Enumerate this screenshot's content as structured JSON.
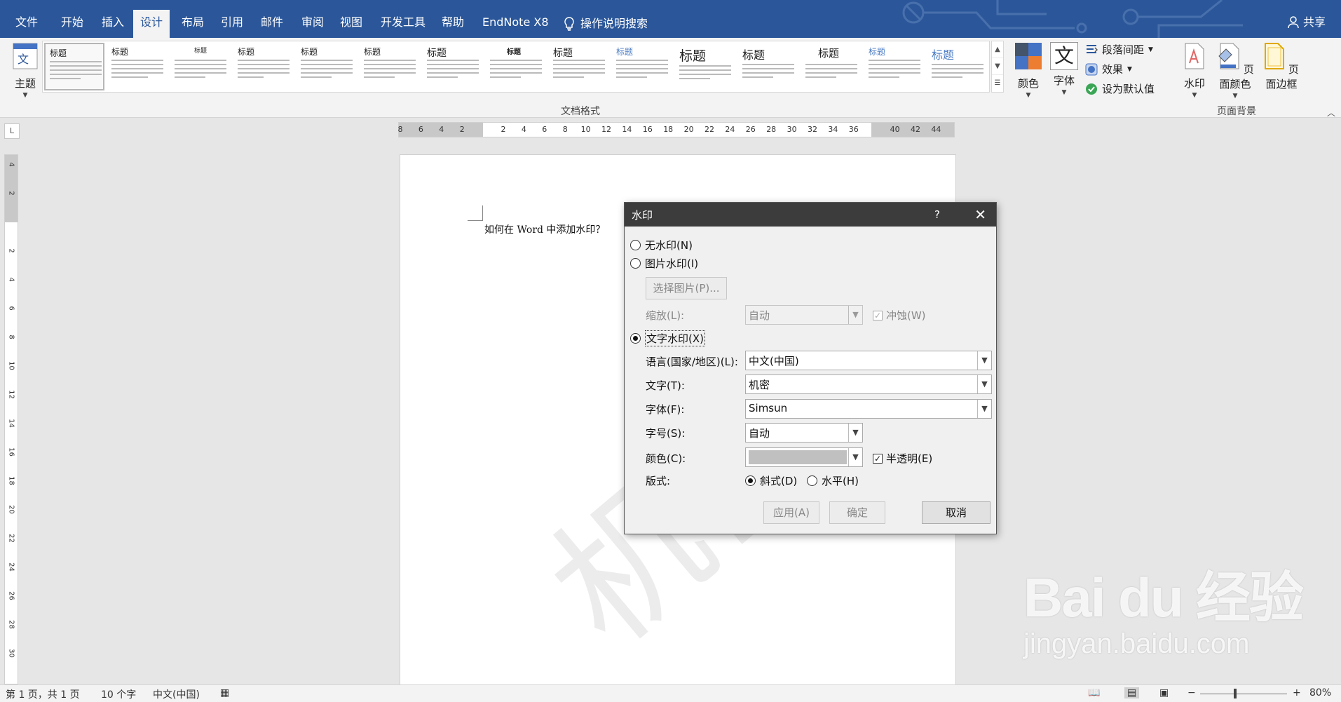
{
  "tabs": [
    "文件",
    "开始",
    "插入",
    "设计",
    "布局",
    "引用",
    "邮件",
    "审阅",
    "视图",
    "开发工具",
    "帮助",
    "EndNote X8"
  ],
  "tab_search": "操作说明搜索",
  "share": "共享",
  "ribbon": {
    "theme_label": "主题",
    "gallery_title": "标题",
    "gallery_group": "文档格式",
    "colors_label": "颜色",
    "fonts_label": "字体",
    "fonts_glyph": "文",
    "paragraph_spacing": "段落间距",
    "effects": "效果",
    "set_default": "设为默认值",
    "watermark": "水印",
    "page_color": "页面颜色",
    "page_borders": "页面边框",
    "bg_group": "页面背景"
  },
  "ruler": {
    "corner": "L",
    "ticks": [
      "8",
      "6",
      "4",
      "2",
      "",
      "2",
      "4",
      "6",
      "8",
      "10",
      "12",
      "14",
      "16",
      "18",
      "20",
      "22",
      "24",
      "26",
      "28",
      "30",
      "32",
      "34",
      "36",
      "",
      "40",
      "42",
      "44"
    ],
    "vticks": [
      "4",
      "2",
      "",
      "2",
      "4",
      "6",
      "8",
      "10",
      "12",
      "14",
      "16",
      "18",
      "20",
      "22",
      "24",
      "26",
      "28",
      "30"
    ]
  },
  "document": {
    "text": "如何在 Word 中添加水印？",
    "watermark_text": "机密"
  },
  "dialog": {
    "title": "水印",
    "help": "?",
    "no_watermark": "无水印(N)",
    "picture_watermark": "图片水印(I)",
    "select_picture": "选择图片(P)...",
    "scale_label": "缩放(L):",
    "scale_value": "自动",
    "washout": "冲蚀(W)",
    "text_watermark": "文字水印(X)",
    "language_label": "语言(国家/地区)(L):",
    "language_value": "中文(中国)",
    "text_label": "文字(T):",
    "text_value": "机密",
    "font_label": "字体(F):",
    "font_value": "Simsun",
    "size_label": "字号(S):",
    "size_value": "自动",
    "color_label": "颜色(C):",
    "semitransparent": "半透明(E)",
    "layout_label": "版式:",
    "diagonal": "斜式(D)",
    "horizontal": "水平(H)",
    "apply": "应用(A)",
    "ok": "确定",
    "cancel": "取消"
  },
  "status": {
    "page": "第 1 页，共 1 页",
    "words": "10 个字",
    "language": "中文(中国)",
    "zoom": "80%"
  },
  "baidu": {
    "logo": "Bai du 经验",
    "url": "jingyan.baidu.com"
  },
  "colors": {
    "brand": "#2b579a",
    "dialog_title": "#3c3c3c"
  }
}
